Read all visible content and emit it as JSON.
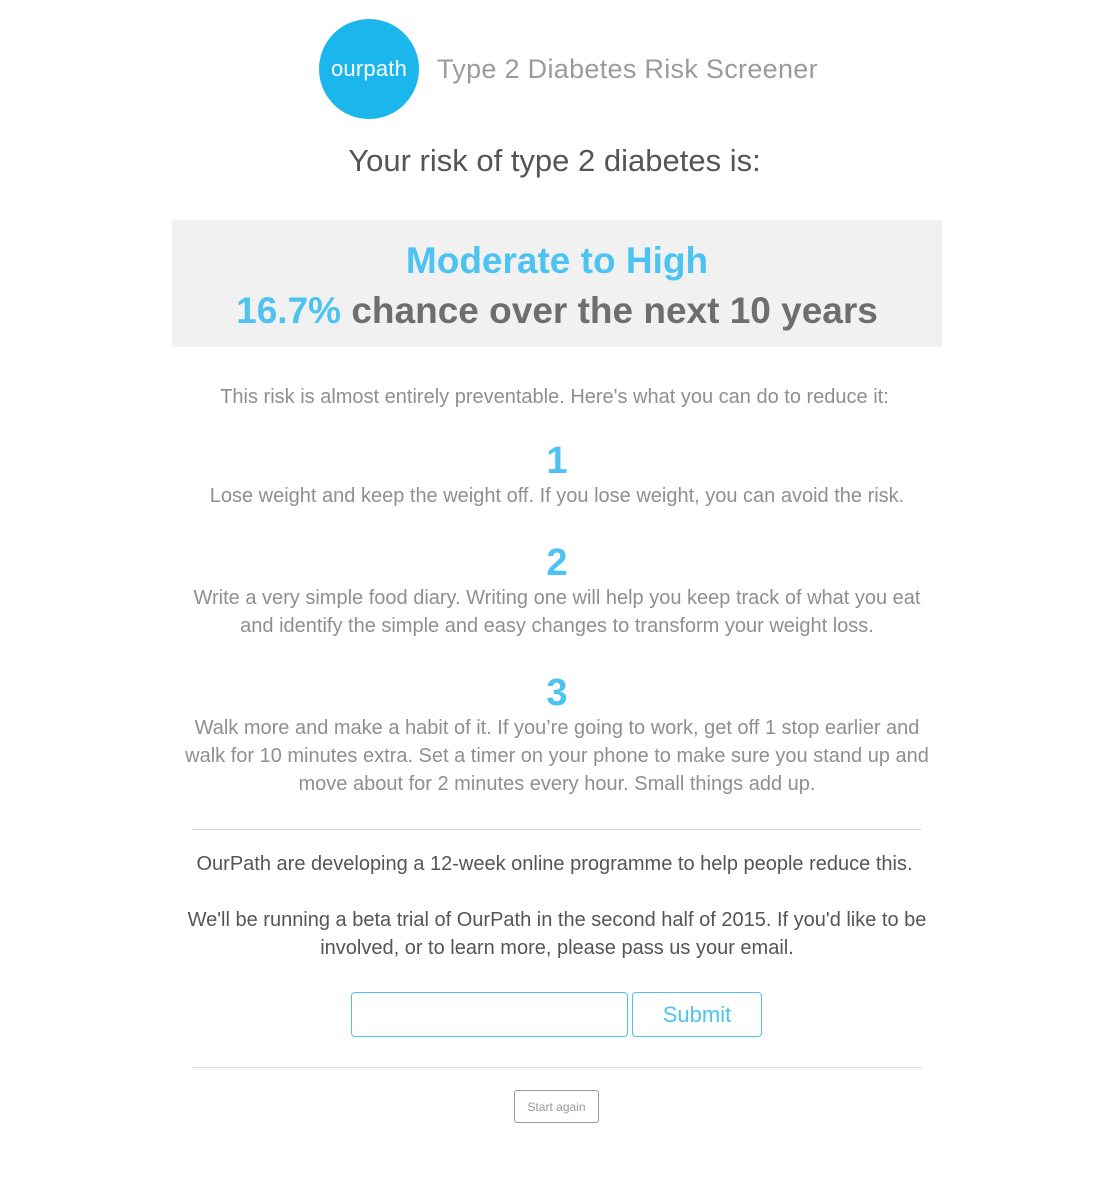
{
  "header": {
    "logo_text": "ourpath",
    "app_title": "Type 2 Diabetes Risk Screener"
  },
  "result": {
    "heading": "Your risk of type 2 diabetes is:",
    "level": "Moderate to High",
    "percentage": "16.7%",
    "description": "chance over the next 10 years"
  },
  "advice": {
    "intro": "This risk is almost entirely preventable. Here's what you can do to reduce it:",
    "tips": [
      {
        "number": "1",
        "text": "Lose weight and keep the weight off. If you lose weight, you can avoid the risk."
      },
      {
        "number": "2",
        "text": "Write a very simple food diary. Writing one will help you keep track of what you eat and identify the simple and easy changes to transform your weight loss."
      },
      {
        "number": "3",
        "text": "Walk more and make a habit of it. If you’re going to work, get off 1 stop earlier and walk for 10 minutes extra. Set a timer on your phone to make sure you stand up and move about for 2 minutes every hour. Small things add up."
      }
    ]
  },
  "signup": {
    "programme_text": "OurPath are developing a 12-week online programme to help people reduce this.",
    "beta_text": "We'll be running a beta trial of OurPath in the second half of 2015. If you'd like to be involved, or to learn more, please pass us your email.",
    "email_value": "",
    "email_placeholder": "",
    "submit_label": "Submit"
  },
  "footer": {
    "restart_label": "Start again"
  },
  "colors": {
    "brand": "#1ab6ec",
    "accent": "#4cc3f0",
    "result_box": "#f1f1f1"
  }
}
